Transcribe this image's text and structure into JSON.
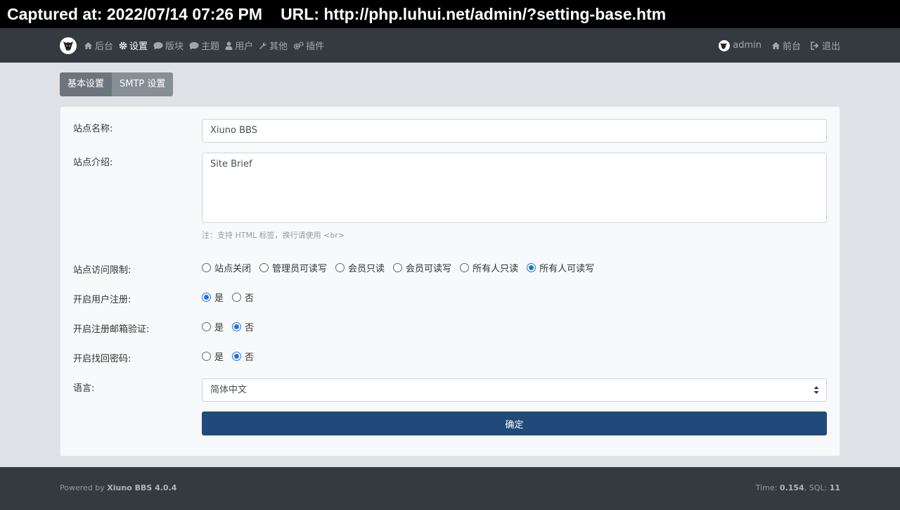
{
  "capture": {
    "captured_label": "Captured at: 2022/07/14 07:26 PM",
    "url_label": "URL: http://php.luhui.net/admin/?setting-base.htm"
  },
  "nav": {
    "left": [
      {
        "label": "后台",
        "icon": "home-icon"
      },
      {
        "label": "设置",
        "icon": "gear-icon",
        "active": true
      },
      {
        "label": "版块",
        "icon": "comment-icon"
      },
      {
        "label": "主题",
        "icon": "comment-icon"
      },
      {
        "label": "用户",
        "icon": "user-icon"
      },
      {
        "label": "其他",
        "icon": "wrench-icon"
      },
      {
        "label": "插件",
        "icon": "gears-icon"
      }
    ],
    "right": [
      {
        "label": "admin",
        "icon": "avatar"
      },
      {
        "label": "前台",
        "icon": "home-icon"
      },
      {
        "label": "退出",
        "icon": "sign-out-icon"
      }
    ]
  },
  "tabs": [
    {
      "label": "基本设置",
      "active": true
    },
    {
      "label": "SMTP 设置",
      "active": false
    }
  ],
  "form": {
    "site_name_label": "站点名称:",
    "site_name_value": "Xiuno BBS",
    "site_brief_label": "站点介绍:",
    "site_brief_value": "Site Brief",
    "site_brief_hint": "注：支持 HTML 标签，换行请使用 <br>",
    "access_label": "站点访问限制:",
    "access_options": [
      "站点关闭",
      "管理员可读写",
      "会员只读",
      "会员可读写",
      "所有人只读",
      "所有人可读写"
    ],
    "access_selected": "所有人可读写",
    "register_label": "开启用户注册:",
    "register_selected": "是",
    "email_verify_label": "开启注册邮箱验证:",
    "email_verify_selected": "否",
    "find_password_label": "开启找回密码:",
    "find_password_selected": "否",
    "yes": "是",
    "no": "否",
    "language_label": "语言:",
    "language_value": "简体中文",
    "submit_label": "确定"
  },
  "footer": {
    "powered_prefix": "Powered by ",
    "powered_name": "Xiuno BBS 4.0.4",
    "time_prefix": "Time: ",
    "time_value": "0.154",
    "sql_prefix": ", SQL: ",
    "sql_value": "11"
  },
  "colors": {
    "navbar": "#343a40",
    "submit": "#1f4a7a",
    "radio_accent": "#1a73e8"
  }
}
